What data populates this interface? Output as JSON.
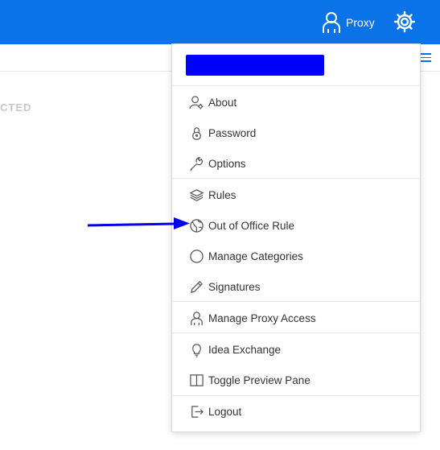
{
  "header": {
    "proxy_label": "Proxy",
    "bg_color": "#0a73e8"
  },
  "background": {
    "section_label_fragment": "CTED"
  },
  "menu": {
    "account_name_redacted": true,
    "groups": [
      {
        "items": [
          {
            "label": "About",
            "icon": "user-settings-icon"
          },
          {
            "label": "Password",
            "icon": "lock-icon"
          },
          {
            "label": "Options",
            "icon": "wrench-icon"
          }
        ]
      },
      {
        "items": [
          {
            "label": "Rules",
            "icon": "layers-icon"
          },
          {
            "label": "Out of Office Rule",
            "icon": "globe-icon"
          },
          {
            "label": "Manage Categories",
            "icon": "circle-icon"
          },
          {
            "label": "Signatures",
            "icon": "pencil-icon"
          }
        ]
      },
      {
        "items": [
          {
            "label": "Manage Proxy Access",
            "icon": "proxy-user-icon"
          }
        ]
      },
      {
        "items": [
          {
            "label": "Idea Exchange",
            "icon": "lightbulb-icon"
          },
          {
            "label": "Toggle Preview Pane",
            "icon": "split-pane-icon"
          }
        ]
      },
      {
        "items": [
          {
            "label": "Logout",
            "icon": "logout-icon"
          }
        ]
      }
    ]
  },
  "annotation": {
    "arrow_color": "#0000ee",
    "points_to": "Out of Office Rule"
  }
}
